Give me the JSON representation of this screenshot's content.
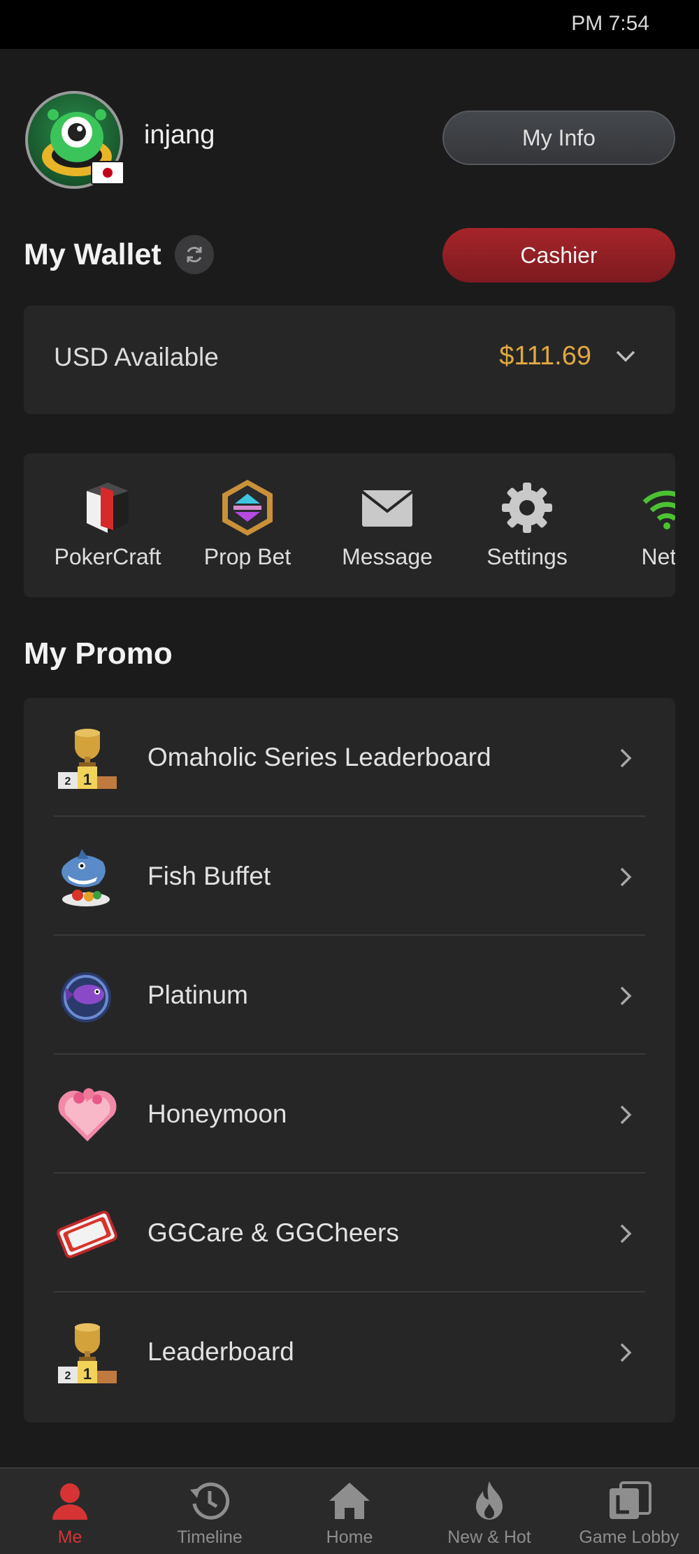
{
  "status_bar": {
    "time": "PM 7:54"
  },
  "profile": {
    "username": "injang",
    "my_info_label": "My Info",
    "flag": "japan-flag-icon"
  },
  "wallet": {
    "title": "My Wallet",
    "cashier_label": "Cashier",
    "balance_label": "USD Available",
    "balance_value": "$111.69",
    "balance_color": "#e0a940"
  },
  "shortcuts": [
    {
      "label": "PokerCraft",
      "icon": "pokercraft-icon"
    },
    {
      "label": "Prop Bet",
      "icon": "prop-bet-icon"
    },
    {
      "label": "Message",
      "icon": "envelope-icon"
    },
    {
      "label": "Settings",
      "icon": "gear-icon"
    },
    {
      "label": "Netw",
      "icon": "wifi-icon"
    }
  ],
  "promo": {
    "title": "My Promo",
    "items": [
      {
        "label": "Omaholic Series Leaderboard",
        "icon": "trophy-podium-icon"
      },
      {
        "label": "Fish Buffet",
        "icon": "shark-icon"
      },
      {
        "label": "Platinum",
        "icon": "platinum-fish-icon"
      },
      {
        "label": "Honeymoon",
        "icon": "heart-cake-icon"
      },
      {
        "label": "GGCare & GGCheers",
        "icon": "thanks-ticket-icon"
      },
      {
        "label": "Leaderboard",
        "icon": "trophy-podium-icon"
      }
    ]
  },
  "bottom_nav": {
    "items": [
      {
        "label": "Me",
        "icon": "person-icon",
        "active": true
      },
      {
        "label": "Timeline",
        "icon": "history-clock-icon"
      },
      {
        "label": "Home",
        "icon": "home-icon"
      },
      {
        "label": "New & Hot",
        "icon": "flame-icon"
      },
      {
        "label": "Game Lobby",
        "icon": "lobby-cards-icon"
      }
    ],
    "active_color": "#d63434"
  }
}
